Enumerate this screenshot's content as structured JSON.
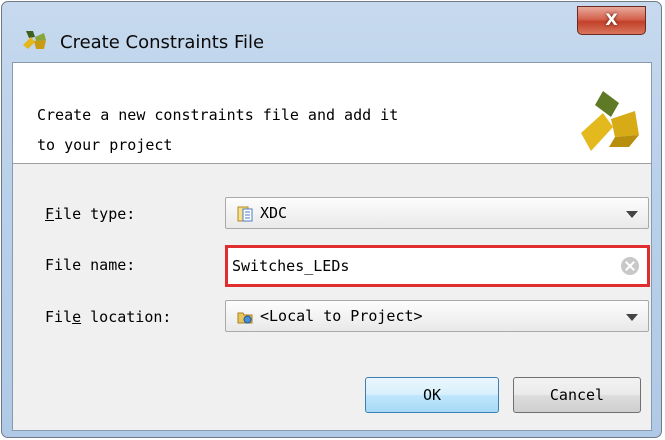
{
  "window": {
    "title": "Create Constraints File",
    "close_label": "X",
    "header_description": "Create a new constraints file and add it\nto your project"
  },
  "form": {
    "file_type": {
      "label_mnemonic": "F",
      "label_rest": "ile type:",
      "value": "XDC",
      "icon": "xdc-file-icon"
    },
    "file_name": {
      "label_mnemonic": "",
      "label_rest": "File name:",
      "value": "Switches_LEDs",
      "clear_icon": "clear-icon"
    },
    "file_location": {
      "label_pre": "Fil",
      "label_mnemonic": "e",
      "label_rest": " location:",
      "value": "<Local to Project>",
      "icon": "folder-icon"
    }
  },
  "buttons": {
    "ok_label": "OK",
    "cancel_label": "Cancel"
  },
  "colors": {
    "highlight_border": "#e02d2d",
    "brand_gold": "#d9b21c",
    "title_bar": "#bad1ea",
    "close_red": "#c2402a"
  }
}
